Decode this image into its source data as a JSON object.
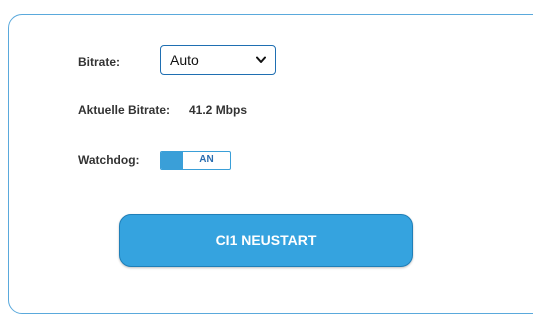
{
  "bitrate": {
    "label": "Bitrate:",
    "selected": "Auto"
  },
  "current_bitrate": {
    "label": "Aktuelle Bitrate:",
    "value": "41.2 Mbps"
  },
  "watchdog": {
    "label": "Watchdog:",
    "state": "AN"
  },
  "actions": {
    "restart_label": "CI1 NEUSTART"
  },
  "colors": {
    "accent": "#35a3df",
    "border": "#5aa9dc",
    "select_border": "#1f6fb2"
  },
  "icons": {
    "select_chevron": "chevron-down-icon"
  }
}
